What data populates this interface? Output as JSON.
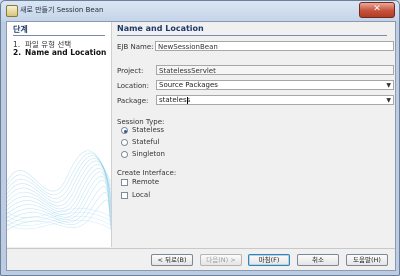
{
  "window": {
    "title": "새로 만들기 Session Bean",
    "close_glyph": "✕"
  },
  "steps": {
    "heading": "단계",
    "items": [
      {
        "num": "1.",
        "label": "파일 유형 선택"
      },
      {
        "num": "2.",
        "label": "Name and Location"
      }
    ]
  },
  "main": {
    "title": "Name and Location",
    "ejb_name": {
      "label": "EJB Name:",
      "value": "NewSessionBean"
    },
    "project": {
      "label": "Project:",
      "value": "StatelessServlet"
    },
    "location": {
      "label": "Location:",
      "value": "Source Packages"
    },
    "package": {
      "label": "Package:",
      "value": "stateless"
    },
    "session_type": {
      "label": "Session Type:",
      "options": [
        {
          "label": "Stateless",
          "selected": true
        },
        {
          "label": "Stateful",
          "selected": false
        },
        {
          "label": "Singleton",
          "selected": false
        }
      ]
    },
    "create_interface": {
      "label": "Create Interface:",
      "options": [
        {
          "label": "Remote",
          "checked": false
        },
        {
          "label": "Local",
          "checked": false
        }
      ]
    }
  },
  "buttons": {
    "back": "< 뒤로(B)",
    "next": "다음(N) >",
    "finish": "마침(F)",
    "cancel": "취소",
    "help": "도움말(H)"
  },
  "colors": {
    "accent": "#2a5da8",
    "heading": "#1f3a6a",
    "wave": "#5fb6e0"
  }
}
